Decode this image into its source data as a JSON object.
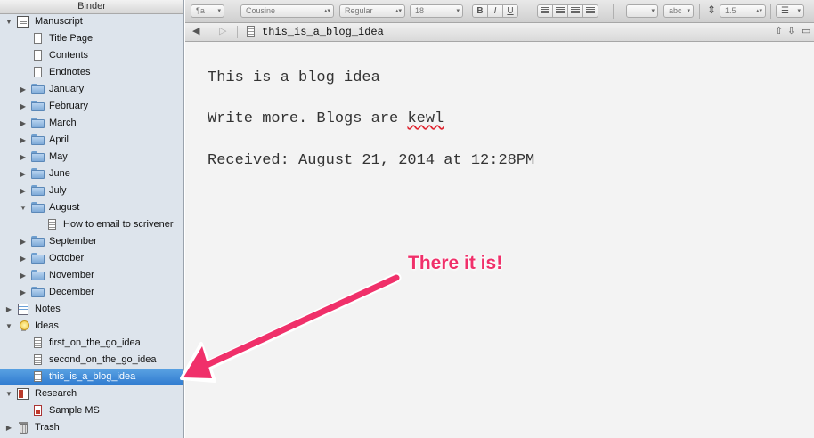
{
  "binder": {
    "header": "Binder",
    "items": [
      {
        "label": "Manuscript",
        "icon": "manuscript-icon",
        "disclosure": "open",
        "level": 0
      },
      {
        "label": "Title Page",
        "icon": "document-icon",
        "level": 1
      },
      {
        "label": "Contents",
        "icon": "document-icon",
        "level": 1
      },
      {
        "label": "Endnotes",
        "icon": "document-icon",
        "level": 1
      },
      {
        "label": "January",
        "icon": "folder-icon",
        "disclosure": "closed",
        "level": 1
      },
      {
        "label": "February",
        "icon": "folder-icon",
        "disclosure": "closed",
        "level": 1
      },
      {
        "label": "March",
        "icon": "folder-icon",
        "disclosure": "closed",
        "level": 1
      },
      {
        "label": "April",
        "icon": "folder-icon",
        "disclosure": "closed",
        "level": 1
      },
      {
        "label": "May",
        "icon": "folder-icon",
        "disclosure": "closed",
        "level": 1
      },
      {
        "label": "June",
        "icon": "folder-icon",
        "disclosure": "closed",
        "level": 1
      },
      {
        "label": "July",
        "icon": "folder-icon",
        "disclosure": "closed",
        "level": 1
      },
      {
        "label": "August",
        "icon": "folder-icon",
        "disclosure": "open",
        "level": 1
      },
      {
        "label": "How to email to scrivener",
        "icon": "document-lines-icon",
        "level": 2
      },
      {
        "label": "September",
        "icon": "folder-icon",
        "disclosure": "closed",
        "level": 1
      },
      {
        "label": "October",
        "icon": "folder-icon",
        "disclosure": "closed",
        "level": 1
      },
      {
        "label": "November",
        "icon": "folder-icon",
        "disclosure": "closed",
        "level": 1
      },
      {
        "label": "December",
        "icon": "folder-icon",
        "disclosure": "closed",
        "level": 1
      },
      {
        "label": "Notes",
        "icon": "notes-icon",
        "disclosure": "closed",
        "level": 0
      },
      {
        "label": "Ideas",
        "icon": "lightbulb-icon",
        "disclosure": "open",
        "level": 0
      },
      {
        "label": "first_on_the_go_idea",
        "icon": "document-lines-icon",
        "level": 1
      },
      {
        "label": "second_on_the_go_idea",
        "icon": "document-lines-icon",
        "level": 1
      },
      {
        "label": "this_is_a_blog_idea",
        "icon": "document-lines-icon",
        "level": 1,
        "selected": true
      },
      {
        "label": "Research",
        "icon": "research-icon",
        "disclosure": "open",
        "level": 0
      },
      {
        "label": "Sample MS",
        "icon": "pdf-icon",
        "level": 1
      },
      {
        "label": "Trash",
        "icon": "trash-icon",
        "disclosure": "closed",
        "level": 0
      }
    ]
  },
  "toolbar": {
    "style_menu": "¶a",
    "font": "Cousine",
    "font_style": "Regular",
    "font_size": "18",
    "bold": "B",
    "italic": "I",
    "underline": "U",
    "text_color_menu": "",
    "highlight": "abc",
    "line_spacing": "1.5"
  },
  "header_bar": {
    "document_title": "this_is_a_blog_idea"
  },
  "editor": {
    "paragraphs": [
      "This is a blog idea",
      "Write more. Blogs are ",
      "Received: August 21, 2014 at 12:28PM"
    ],
    "misspelled_word": "kewl"
  },
  "annotation": {
    "callout_text": "There it is!",
    "color": "#f0306a"
  },
  "colors": {
    "binder_bg": "#dde4ec",
    "selection": "#2f7bd0",
    "editor_bg": "#f3f3f3"
  }
}
